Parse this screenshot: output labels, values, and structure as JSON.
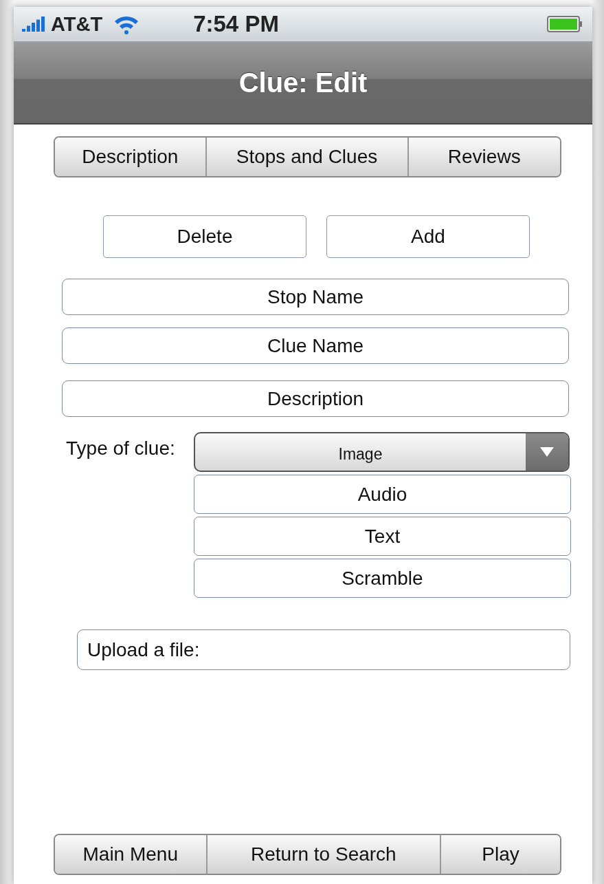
{
  "status_bar": {
    "carrier": "AT&T",
    "time": "7:54 PM"
  },
  "nav_bar": {
    "title": "Clue: Edit"
  },
  "tabs": [
    {
      "label": "Description"
    },
    {
      "label": "Stops and Clues"
    },
    {
      "label": "Reviews"
    }
  ],
  "actions": [
    "Delete",
    "Add"
  ],
  "fields": [
    {
      "placeholder": "Stop Name"
    },
    {
      "placeholder": "Clue Name"
    },
    {
      "placeholder": "Description"
    }
  ],
  "clue_type": {
    "label": "Type of clue:",
    "value": "Image",
    "expanded": true,
    "options": [
      "Audio",
      "Text",
      "Scramble"
    ]
  },
  "upload": {
    "label": "Upload a file:"
  },
  "bottom_tabs": [
    {
      "label": "Main Menu"
    },
    {
      "label": "Return to Search"
    },
    {
      "label": "Play"
    }
  ]
}
